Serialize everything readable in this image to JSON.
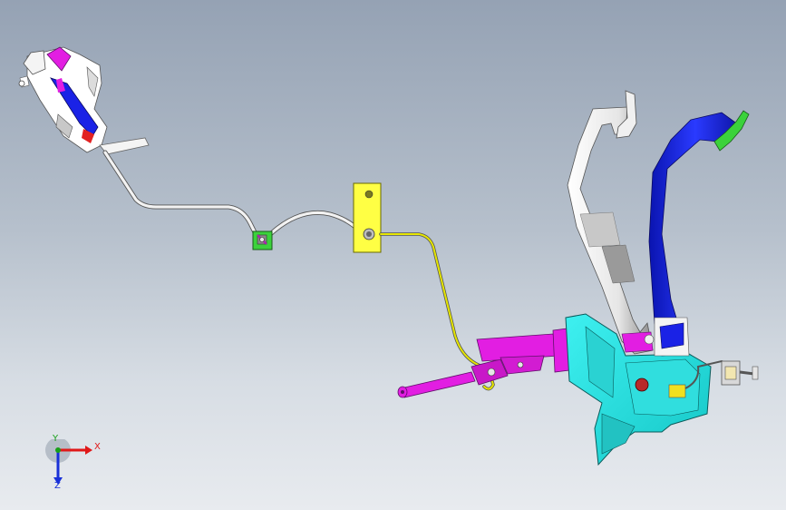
{
  "window": {
    "title": "",
    "background_top": "#95a2b4",
    "background_bottom": "#e8ebef"
  },
  "model": {
    "parts": [
      {
        "name": "clutch-master-cylinder-reservoir",
        "color": "#ffffff"
      },
      {
        "name": "hydraulic-line-white",
        "color": "#f2f2f2"
      },
      {
        "name": "line-clip",
        "color": "#3bd23b"
      },
      {
        "name": "mounting-bracket",
        "color": "#ffff44"
      },
      {
        "name": "hydraulic-line-yellow",
        "color": "#e6e600"
      },
      {
        "name": "slave-cylinder",
        "color": "#e21ee2"
      },
      {
        "name": "pedal-box-bracket",
        "color": "#22e6e6"
      },
      {
        "name": "clutch-pedal-arm",
        "color": "#ffffff"
      },
      {
        "name": "brake-pedal-arm",
        "color": "#1a22e6"
      },
      {
        "name": "pedal-pad",
        "color": "#3bd23b"
      }
    ]
  },
  "triad": {
    "x_label": "X",
    "y_label": "Y",
    "z_label": "Z",
    "x_color": "#e01818",
    "y_color": "#18a018",
    "z_color": "#1830d8"
  }
}
